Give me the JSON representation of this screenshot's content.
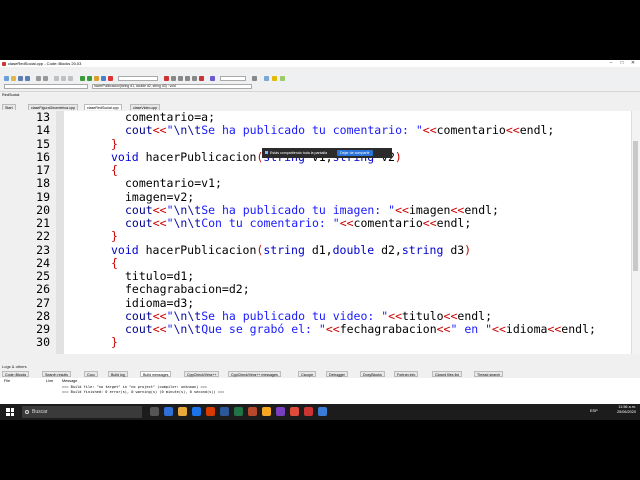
{
  "window": {
    "title": "claseRedSocial.cpp - Code::Blocks 20.03"
  },
  "menu": [
    "File",
    "Edit",
    "View",
    "Search",
    "Project",
    "Build",
    "Debug",
    "Fortran",
    "wxSmith",
    "Tools",
    "Tools+",
    "Plugins",
    "DoxyBlocks",
    "Settings",
    "Help"
  ],
  "toolbar": {
    "scope_value": "hacerPublicacion(string d1, double d2, string d3) : void"
  },
  "share_banner": {
    "message": "Estás compartiendo toda la pantalla",
    "stop_label": "Dejar de compartir"
  },
  "management": {
    "tab_label": "RedSocial"
  },
  "editor_tabs": [
    {
      "label": "Start here",
      "active": false
    },
    {
      "label": "claseFiguraGeometrica.cpp",
      "active": false
    },
    {
      "label": "claseRedSocial.cpp",
      "active": true
    },
    {
      "label": "claseVideo.cpp",
      "active": false
    }
  ],
  "code_lines": [
    {
      "num": "13",
      "text": "comentario=a;"
    },
    {
      "num": "14",
      "text": "cout<<\"\\n\\tSe ha publicado tu comentario: \"<<comentario<<endl;"
    },
    {
      "num": "15",
      "text": "}"
    },
    {
      "num": "16",
      "text": "void hacerPublicacion(string v1,string v2)"
    },
    {
      "num": "17",
      "text": "{"
    },
    {
      "num": "18",
      "text": "comentario=v1;"
    },
    {
      "num": "19",
      "text": "imagen=v2;"
    },
    {
      "num": "20",
      "text": "cout<<\"\\n\\tSe ha publicado tu imagen: \"<<imagen<<endl;"
    },
    {
      "num": "21",
      "text": "cout<<\"\\n\\tCon tu comentario: \"<<comentario<<endl;"
    },
    {
      "num": "22",
      "text": "}"
    },
    {
      "num": "23",
      "text": "void hacerPublicacion(string d1,double d2,string d3)"
    },
    {
      "num": "24",
      "text": "{"
    },
    {
      "num": "25",
      "text": "titulo=d1;"
    },
    {
      "num": "26",
      "text": "fechagrabacion=d2;"
    },
    {
      "num": "27",
      "text": "idioma=d3;"
    },
    {
      "num": "28",
      "text": "cout<<\"\\n\\tSe ha publicado tu video: \"<<titulo<<endl;"
    },
    {
      "num": "29",
      "text": "cout<<\"\\n\\tQue se grabó el: \"<<fechagrabacion<<\" en \"<<idioma<<endl;"
    },
    {
      "num": "30",
      "text": "}"
    }
  ],
  "logs": {
    "title": "Logs & others",
    "tabs": [
      "Code::Blocks",
      "Search results",
      "Cccc",
      "Build log",
      "Build messages",
      "CppCheck/Vera++",
      "CppCheck/Vera++ messages",
      "Cscope",
      "Debugger",
      "DoxyBlocks",
      "Fortran info",
      "Closed files list",
      "Thread search"
    ],
    "active_tab": "Build messages",
    "columns": [
      "File",
      "Line",
      "Message"
    ],
    "messages": [
      "=== Build file: \"no target\" in \"no project\" (compiler: unknown) ===",
      "=== Build finished: 0 error(s), 0 warning(s) (0 minute(s), 0 second(s)) ==="
    ]
  },
  "taskbar": {
    "search_placeholder": "Buscar",
    "lang": "ESP",
    "time": "11:56 a.m.",
    "date": "25/06/2020"
  }
}
